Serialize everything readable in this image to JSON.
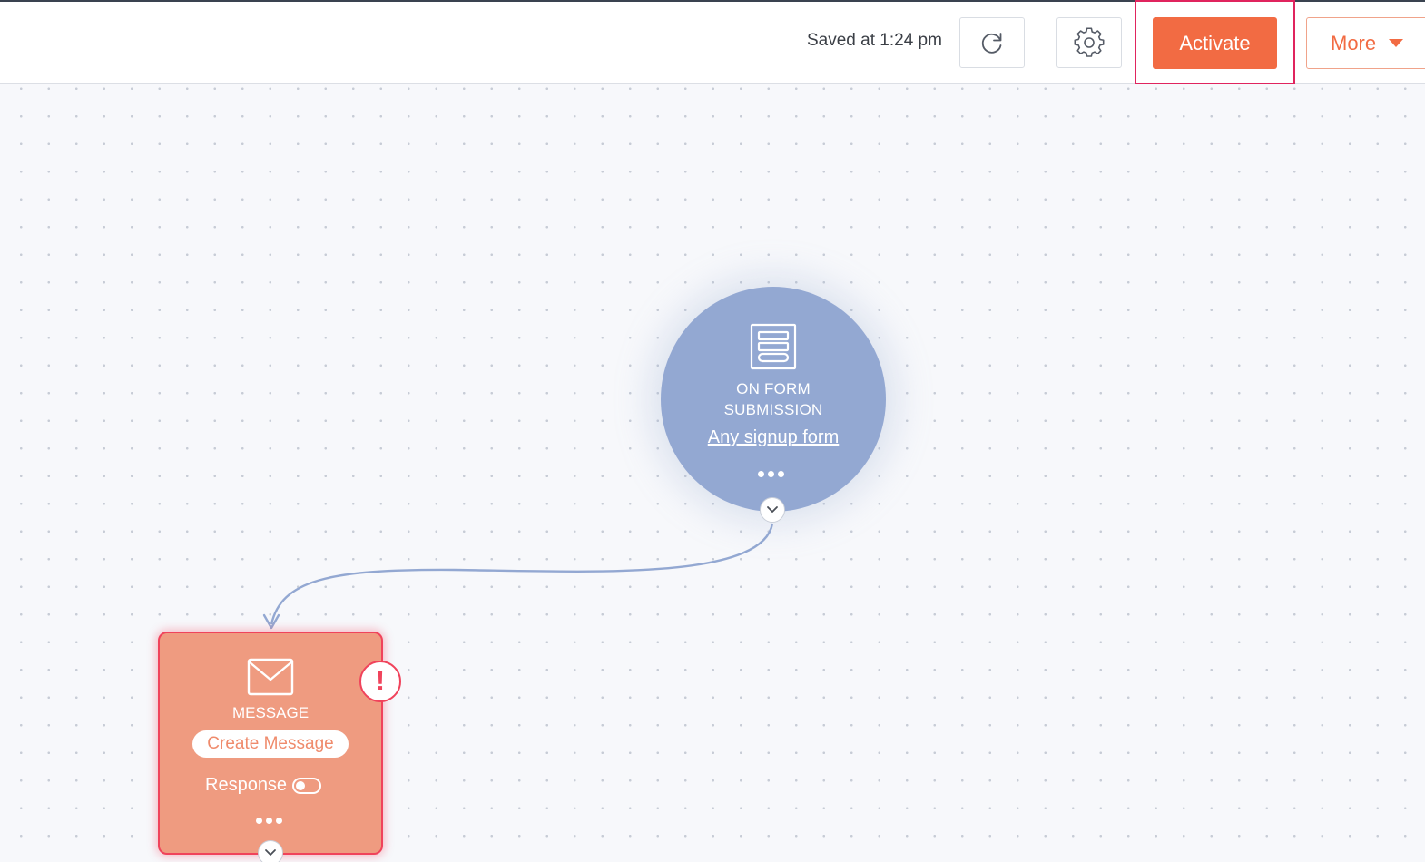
{
  "toolbar": {
    "saved_status": "Saved at 1:24 pm",
    "refresh_icon": "refresh-icon",
    "settings_icon": "gear-icon",
    "activate_label": "Activate",
    "more_label": "More"
  },
  "workflow": {
    "trigger": {
      "icon": "form-icon",
      "title": "ON FORM SUBMISSION",
      "link": "Any signup form"
    },
    "message": {
      "icon": "envelope-icon",
      "title": "MESSAGE",
      "create_button": "Create Message",
      "response_label": "Response",
      "response_enabled": false,
      "alert": "!"
    }
  },
  "colors": {
    "accent": "#f26b43",
    "trigger_node": "#93a8d2",
    "message_node": "#ef9b80",
    "error": "#f0435b",
    "highlight": "#e0245e"
  }
}
